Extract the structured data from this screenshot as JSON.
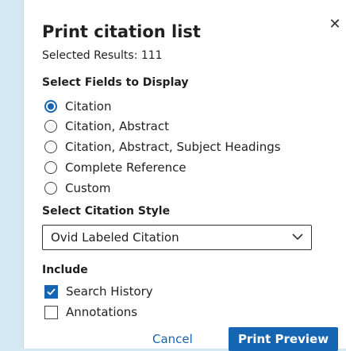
{
  "dialog": {
    "title": "Print citation list",
    "subtitle": "Selected Results: 111",
    "close_icon": "close-icon"
  },
  "fields": {
    "heading": "Select Fields to Display",
    "selected": "Citation",
    "options": [
      {
        "label": "Citation",
        "checked": true
      },
      {
        "label": "Citation, Abstract",
        "checked": false
      },
      {
        "label": "Citation, Abstract, Subject Headings",
        "checked": false
      },
      {
        "label": "Complete Reference",
        "checked": false
      },
      {
        "label": "Custom",
        "checked": false
      }
    ]
  },
  "style": {
    "heading": "Select Citation Style",
    "selected_value": "Ovid Labeled Citation",
    "icon": "chevron-down-icon"
  },
  "include": {
    "heading": "Include",
    "options": [
      {
        "label": "Search History",
        "checked": true
      },
      {
        "label": "Annotations",
        "checked": false
      }
    ]
  },
  "actions": {
    "cancel": "Cancel",
    "primary": "Print Preview"
  },
  "colors": {
    "accent": "#1566b2",
    "backdrop": "#d4e8f3"
  }
}
